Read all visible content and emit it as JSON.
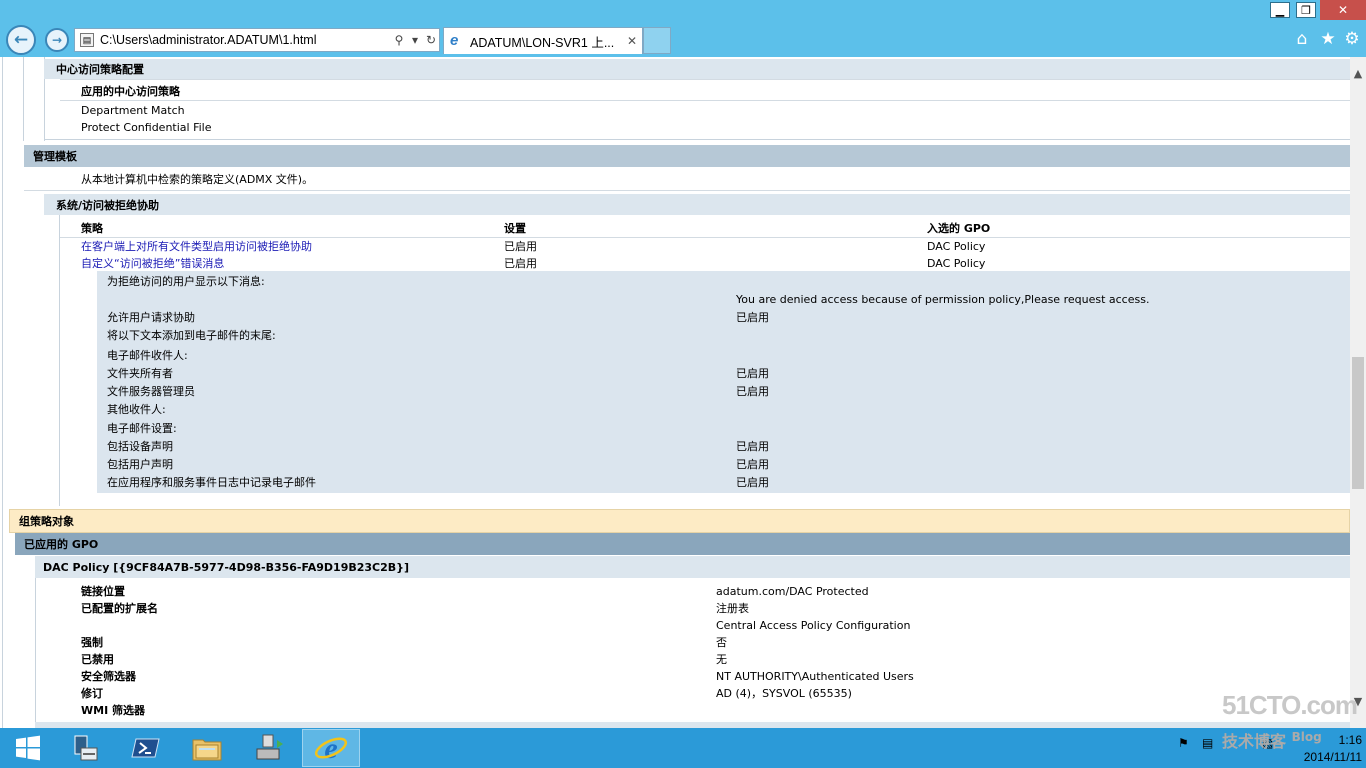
{
  "window": {
    "minimize_label": "▁",
    "maximize_label": "❐",
    "close_label": "✕"
  },
  "browser": {
    "address": "C:\\Users\\administrator.ADATUM\\1.html",
    "tab_title": "ADATUM\\LON-SVR1 上...",
    "icons": [
      "back-icon",
      "forward-icon",
      "search-icon",
      "dropdown-icon",
      "refresh-icon",
      "close-icon",
      "home-icon",
      "star-icon",
      "gear-icon"
    ]
  },
  "report": {
    "cap_section": "中心访问策略配置",
    "cap_header": "应用的中心访问策略",
    "cap_items": [
      "Department Match",
      "Protect Confidential File"
    ],
    "admin_templates": "管理模板",
    "admx_note": "从本地计算机中检索的策略定义(ADMX 文件)。",
    "access_denied_section": "系统/访问被拒绝协助",
    "policy_columns": [
      "策略",
      "设置",
      "入选的 GPO"
    ],
    "policies": [
      {
        "name": "在客户端上对所有文件类型启用访问被拒绝协助",
        "setting": "已启用",
        "gpo": "DAC Policy"
      },
      {
        "name": "自定义“访问被拒绝”错误消息",
        "setting": "已启用",
        "gpo": "DAC Policy"
      }
    ],
    "details": [
      {
        "label": "为拒绝访问的用户显示以下消息:",
        "value": ""
      },
      {
        "label": "",
        "value": "You are denied access because of permission policy,Please request access."
      },
      {
        "label": "允许用户请求协助",
        "value": "已启用"
      },
      {
        "label": "将以下文本添加到电子邮件的末尾:",
        "value": ""
      },
      {
        "label": "电子邮件收件人:",
        "value": ""
      },
      {
        "label": "文件夹所有者",
        "value": "已启用"
      },
      {
        "label": "文件服务器管理员",
        "value": "已启用"
      },
      {
        "label": "其他收件人:",
        "value": ""
      },
      {
        "label": "电子邮件设置:",
        "value": ""
      },
      {
        "label": "包括设备声明",
        "value": "已启用"
      },
      {
        "label": "包括用户声明",
        "value": "已启用"
      },
      {
        "label": "在应用程序和服务事件日志中记录电子邮件",
        "value": "已启用"
      }
    ],
    "gpo_object": "组策略对象",
    "applied_gpo": "已应用的 GPO",
    "dac_policy": "DAC Policy [{9CF84A7B-5977-4D98-B356-FA9D19B23C2B}]",
    "gpo_props": [
      {
        "label": "链接位置",
        "value": "adatum.com/DAC Protected"
      },
      {
        "label": "已配置的扩展名",
        "value": "注册表"
      },
      {
        "label": "",
        "value": "Central Access Policy Configuration"
      },
      {
        "label": "强制",
        "value": "否"
      },
      {
        "label": "已禁用",
        "value": "无"
      },
      {
        "label": "安全筛选器",
        "value": "NT AUTHORITY\\Authenticated Users"
      },
      {
        "label": "修订",
        "value": "AD (4)，SYSVOL (65535)"
      },
      {
        "label": "WMI 筛选器",
        "value": ""
      }
    ]
  },
  "taskbar": {
    "apps": [
      "server-manager-icon",
      "powershell-icon",
      "file-explorer-icon",
      "network-icon",
      "internet-explorer-icon"
    ],
    "time": "1:16",
    "date": "2014/11/11"
  },
  "watermark": {
    "site": "51CTO.com",
    "tag": "技术博客",
    "blog": "Blog"
  },
  "colors": {
    "chrome": "#5cc0ea",
    "section_header": "#b6c8d6",
    "subsection_header": "#dce6ee",
    "detail_bg": "#dbe5ee",
    "gpo_object_bg": "#fdebc5",
    "applied_gpo_bg": "#8aa6bc",
    "link": "#1b1bb5",
    "taskbar": "#2b9ad8"
  }
}
